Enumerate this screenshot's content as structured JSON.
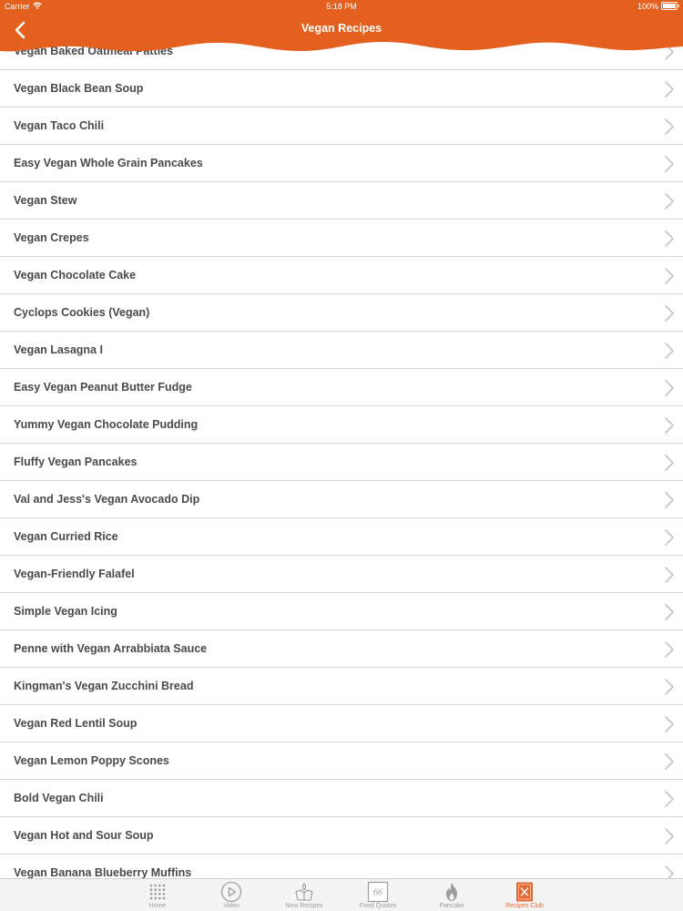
{
  "status_bar": {
    "carrier": "Carrier",
    "time": "5:18 PM",
    "battery": "100%"
  },
  "header": {
    "title": "Vegan Recipes",
    "color": "#e3601f",
    "back_icon": "chevron-left-icon"
  },
  "recipes": [
    "Vegan Baked Oatmeal Patties",
    "Vegan Black Bean Soup",
    "Vegan Taco Chili",
    "Easy Vegan Whole Grain Pancakes",
    "Vegan Stew",
    "Vegan Crepes",
    "Vegan Chocolate Cake",
    "Cyclops Cookies (Vegan)",
    "Vegan Lasagna I",
    "Easy Vegan Peanut Butter Fudge",
    "Yummy Vegan Chocolate Pudding",
    "Fluffy Vegan Pancakes",
    "Val and Jess's Vegan Avocado Dip",
    "Vegan Curried Rice",
    "Vegan-Friendly Falafel",
    "Simple Vegan Icing",
    "Penne with Vegan Arrabbiata Sauce",
    "Kingman's Vegan Zucchini Bread",
    "Vegan Red Lentil Soup",
    "Vegan Lemon Poppy Scones",
    "Bold Vegan Chili",
    "Vegan Hot and Sour Soup",
    "Vegan Banana Blueberry Muffins"
  ],
  "tabbar": {
    "active_color": "#e8642c",
    "tabs": [
      {
        "label": "Home",
        "icon": "grid-dots-icon"
      },
      {
        "label": "Video",
        "icon": "play-circle-icon"
      },
      {
        "label": "New Recipes",
        "icon": "recipe-hands-icon"
      },
      {
        "label": "Food Quotes",
        "icon": "quote-icon",
        "icon_text": "66"
      },
      {
        "label": "Pancake",
        "icon": "flame-icon"
      },
      {
        "label": "Recipes Club",
        "icon": "recipe-book-icon",
        "active": true
      }
    ]
  }
}
